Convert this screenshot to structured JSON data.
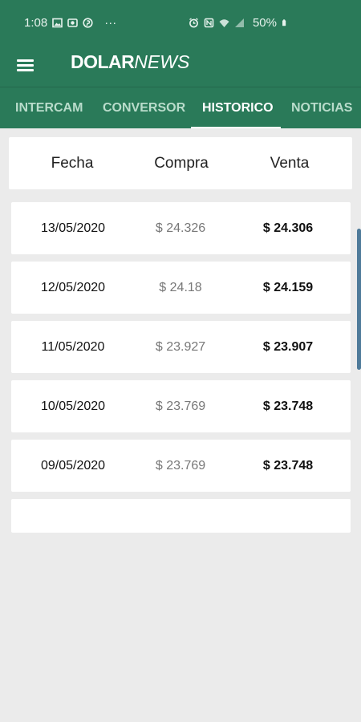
{
  "status_bar": {
    "time": "1:08",
    "more": "···",
    "battery": "50%"
  },
  "app": {
    "logo_part1": "DOLAR",
    "logo_part2": "NEWS"
  },
  "tabs": [
    {
      "label": "INTERCAM",
      "active": false
    },
    {
      "label": "CONVERSOR",
      "active": false
    },
    {
      "label": "HISTORICO",
      "active": true
    },
    {
      "label": "NOTICIAS",
      "active": false
    }
  ],
  "table": {
    "headers": [
      "Fecha",
      "Compra",
      "Venta"
    ],
    "rows": [
      {
        "date": "13/05/2020",
        "buy": "$ 24.326",
        "sell": "$ 24.306"
      },
      {
        "date": "12/05/2020",
        "buy": "$ 24.18",
        "sell": "$ 24.159"
      },
      {
        "date": "11/05/2020",
        "buy": "$ 23.927",
        "sell": "$ 23.907"
      },
      {
        "date": "10/05/2020",
        "buy": "$ 23.769",
        "sell": "$ 23.748"
      },
      {
        "date": "09/05/2020",
        "buy": "$ 23.769",
        "sell": "$ 23.748"
      }
    ]
  },
  "colors": {
    "primary": "#2a7a59",
    "background": "#ebebeb",
    "card": "#ffffff",
    "tab_inactive": "#b9dccb"
  }
}
